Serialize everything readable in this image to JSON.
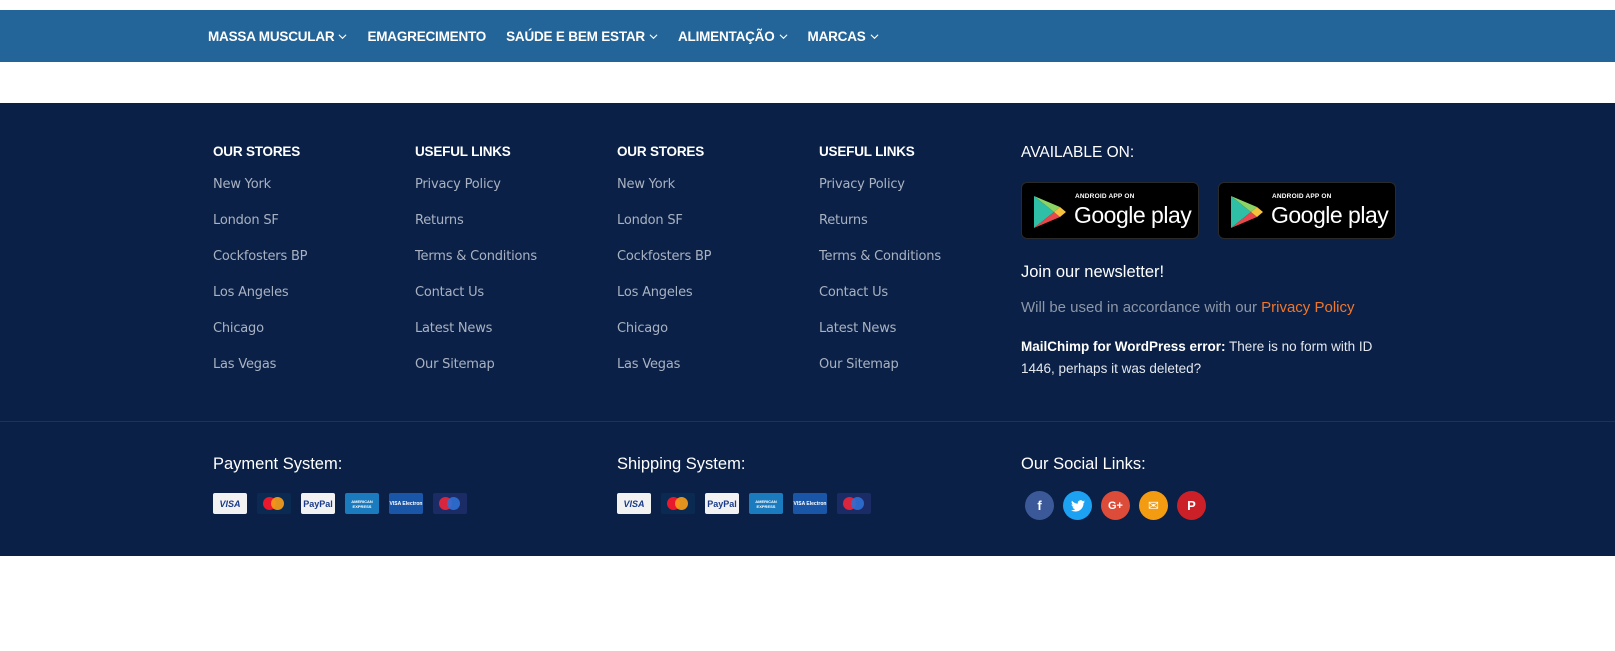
{
  "nav": {
    "items": [
      {
        "label": "MASSA MUSCULAR",
        "has_dropdown": true
      },
      {
        "label": "EMAGRECIMENTO",
        "has_dropdown": false
      },
      {
        "label": "SAÚDE E BEM ESTAR",
        "has_dropdown": true
      },
      {
        "label": "ALIMENTAÇÃO",
        "has_dropdown": true
      },
      {
        "label": "MARCAS",
        "has_dropdown": true
      }
    ]
  },
  "footer": {
    "columns": [
      {
        "title": "OUR STORES",
        "links": [
          "New York",
          "London SF",
          "Cockfosters BP",
          "Los Angeles",
          "Chicago",
          "Las Vegas"
        ]
      },
      {
        "title": "USEFUL LINKS",
        "links": [
          "Privacy Policy",
          "Returns",
          "Terms & Conditions",
          "Contact Us",
          "Latest News",
          "Our Sitemap"
        ]
      },
      {
        "title": "OUR STORES",
        "links": [
          "New York",
          "London SF",
          "Cockfosters BP",
          "Los Angeles",
          "Chicago",
          "Las Vegas"
        ]
      },
      {
        "title": "USEFUL LINKS",
        "links": [
          "Privacy Policy",
          "Returns",
          "Terms & Conditions",
          "Contact Us",
          "Latest News",
          "Our Sitemap"
        ]
      }
    ],
    "available_on": "AVAILABLE ON:",
    "badges": [
      {
        "small": "ANDROID APP ON",
        "big": "Google play"
      },
      {
        "small": "ANDROID APP ON",
        "big": "Google play"
      }
    ],
    "newsletter": {
      "title": "Join our newsletter!",
      "note": "Will be used in accordance with our ",
      "policy_link": "Privacy Policy",
      "error_bold": "MailChimp for WordPress error:",
      "error_text": " There is no form with ID 1446, perhaps it was deleted?"
    },
    "payment": {
      "title": "Payment System:",
      "cards": [
        {
          "name": "visa",
          "label": "VISA"
        },
        {
          "name": "mastercard",
          "label": ""
        },
        {
          "name": "paypal",
          "label": "PayPal"
        },
        {
          "name": "amex",
          "label": "AMERICAN EXPRESS"
        },
        {
          "name": "visa-electron",
          "label": "VISA Electron"
        },
        {
          "name": "maestro",
          "label": ""
        }
      ]
    },
    "shipping": {
      "title": "Shipping System:",
      "cards": [
        {
          "name": "visa",
          "label": "VISA"
        },
        {
          "name": "mastercard",
          "label": ""
        },
        {
          "name": "paypal",
          "label": "PayPal"
        },
        {
          "name": "amex",
          "label": "AMERICAN EXPRESS"
        },
        {
          "name": "visa-electron",
          "label": "VISA Electron"
        },
        {
          "name": "maestro",
          "label": ""
        }
      ]
    },
    "social": {
      "title": "Our Social Links:",
      "links": [
        {
          "name": "facebook",
          "glyph": "f",
          "color": "#3b5998"
        },
        {
          "name": "twitter",
          "glyph": "t",
          "color": "#1da1f2"
        },
        {
          "name": "google-plus",
          "glyph": "G+",
          "color": "#dd4b39"
        },
        {
          "name": "email",
          "glyph": "✉",
          "color": "#f39c12"
        },
        {
          "name": "pinterest",
          "glyph": "P",
          "color": "#cb2027"
        }
      ]
    }
  }
}
